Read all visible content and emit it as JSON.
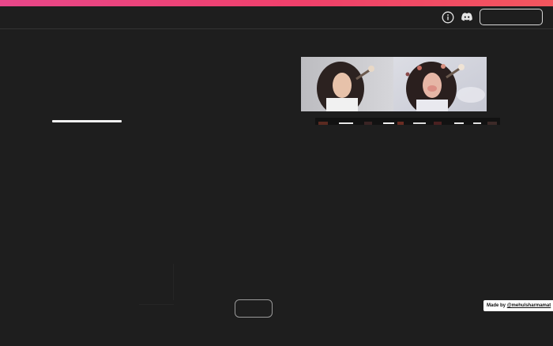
{
  "header": {
    "accent_gradient": [
      "#e8478a",
      "#f0406a",
      "#f2565e"
    ],
    "icons": [
      "info-icon",
      "discord-icon"
    ],
    "action_button_label": ""
  },
  "main": {
    "hero_image": {
      "alt": "woman before and after"
    },
    "thumbnail_strip": {
      "count": 8
    },
    "center_button_label": ""
  },
  "footer": {
    "made_by_prefix": "Made by ",
    "made_by_handle": "@mehulsharmamat"
  },
  "colors": {
    "background": "#1e1e1e",
    "border": "#333333",
    "badge_bg": "#ffffff"
  }
}
